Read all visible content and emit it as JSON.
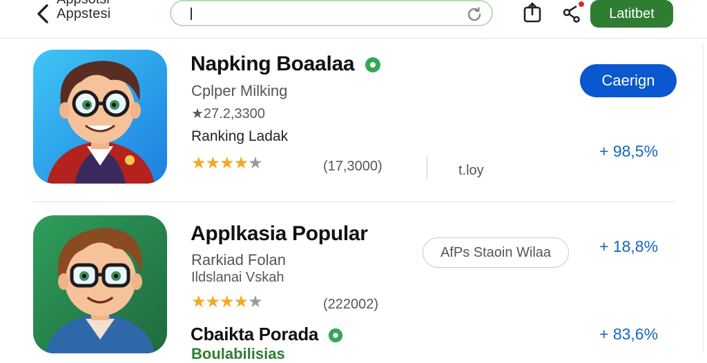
{
  "header": {
    "title_top": "Appsotsi",
    "title": "Appstesi",
    "search": {
      "value": ""
    },
    "action_button": "Latitbet"
  },
  "apps": [
    {
      "name": "Napking Boaalaa",
      "subtitle": "Cplper Milking",
      "rating_line": "★27.2,3300",
      "category": "Ranking Ladak",
      "stars": 4,
      "reviews": "(17,3000)",
      "extra": "t.loy",
      "button": "Caerign",
      "change": "+ 98,5%"
    },
    {
      "name": "Applkasia Popular",
      "subtitle": "Rarkiad Folan",
      "subtitle2": "Ildslanai Vskah",
      "stars": 4,
      "reviews": "(222002)",
      "chip": "AfPs Staoin Wilaa",
      "change": "+ 18,8%"
    },
    {
      "name": "Cbaikta Porada",
      "change": "+ 83,6%",
      "cut_line": "Boulabilisias"
    }
  ],
  "colors": {
    "accent_green": "#2e7d32",
    "primary_blue": "#0b57d0",
    "change_blue": "#1565c0",
    "star": "#f5a623",
    "verified_green": "#34a853"
  }
}
